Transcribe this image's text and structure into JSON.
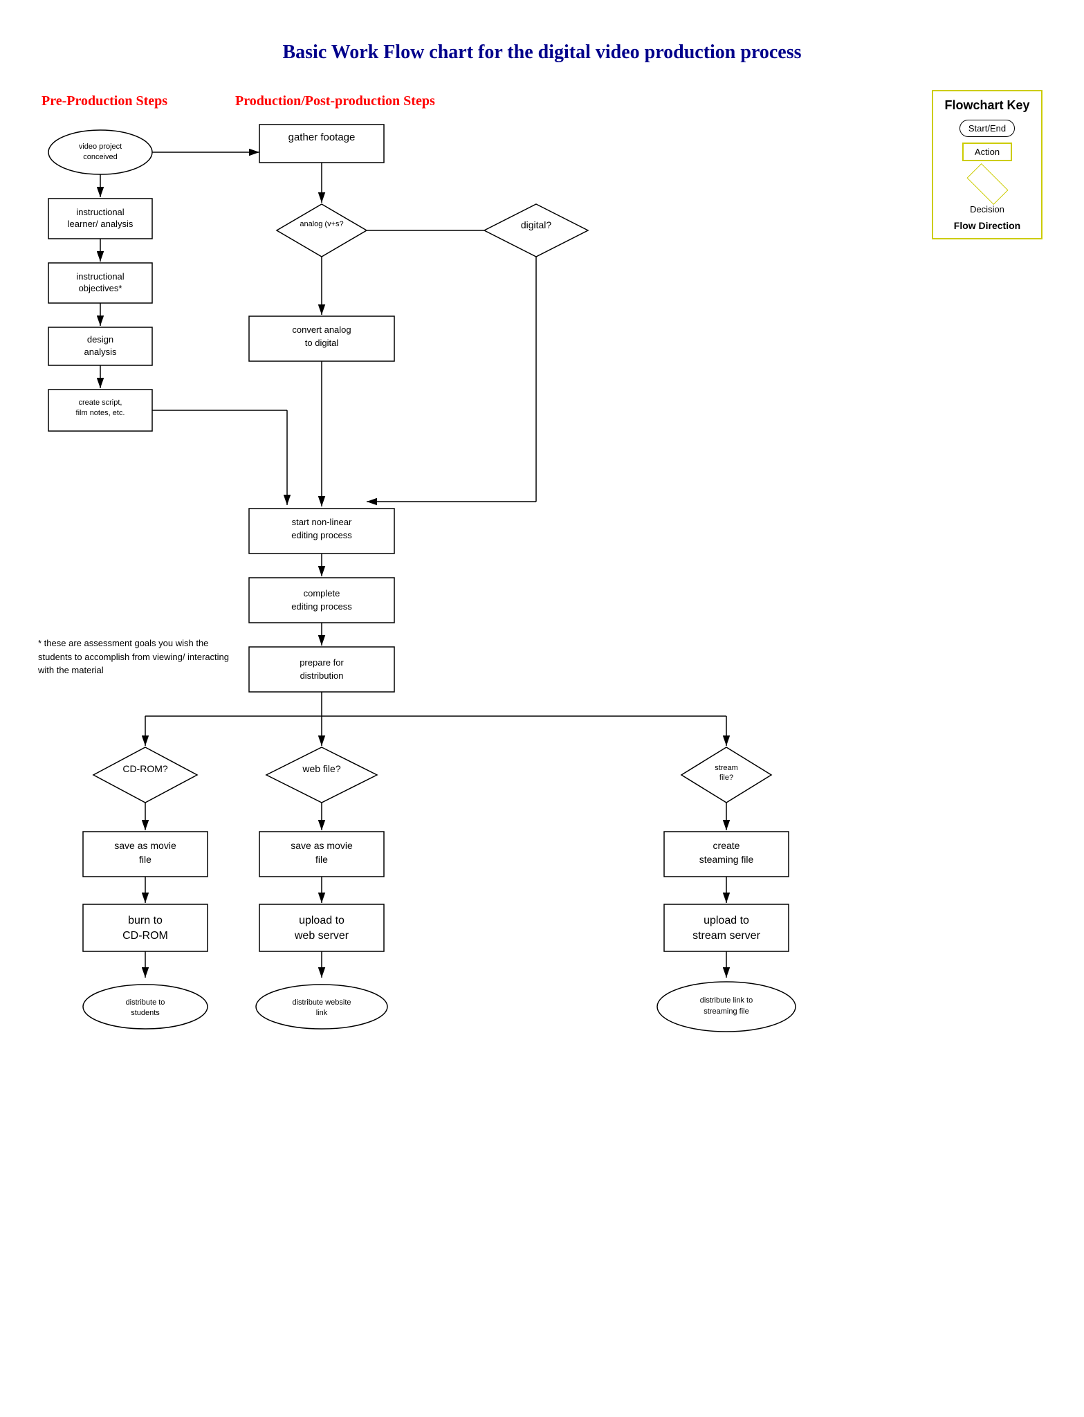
{
  "title": "Basic Work Flow chart for the digital video production process",
  "sectionLabels": {
    "pre": "Pre-Production Steps",
    "prod": "Production/Post-production Steps"
  },
  "key": {
    "title": "Flowchart Key",
    "startEnd": "Start/End",
    "action": "Action",
    "decision": "Decision",
    "flowDirection": "Flow Direction"
  },
  "footnote": "* these are assessment goals you wish the students to accomplish from viewing/ interacting with the material",
  "nodes": {
    "videoProjectConceived": "video project conceived",
    "instructionalLearner": "instructional learner/ analysis",
    "instructionalObjectives": "instructional objectives*",
    "designAnalysis": "design analysis",
    "createScript": "create script, film notes, etc.",
    "gatherFootage": "gather footage",
    "analogDecision": "analog (v+s?",
    "digitalDecision": "digital?",
    "convertAnalog": "convert analog to digital",
    "startNonLinear": "start non-linear editing process",
    "completeEditing": "complete editing process",
    "prepareDistribution": "prepare for distribution",
    "cdromDecision": "CD-ROM?",
    "webFileDecision": "web file?",
    "streamFileDecision": "stream file?",
    "saveMovieFileCd": "save as movie file",
    "saveMovieFileWeb": "save as movie file",
    "createStreamingFile": "create steaming file",
    "burnToCdrom": "burn to CD-ROM",
    "uploadWebServer": "upload to web server",
    "uploadStreamServer": "upload to stream server",
    "distributeStudents": "distribute to students",
    "distributeWebLink": "distribute website link",
    "distributeLinkStreaming": "distribute link to streaming file"
  }
}
